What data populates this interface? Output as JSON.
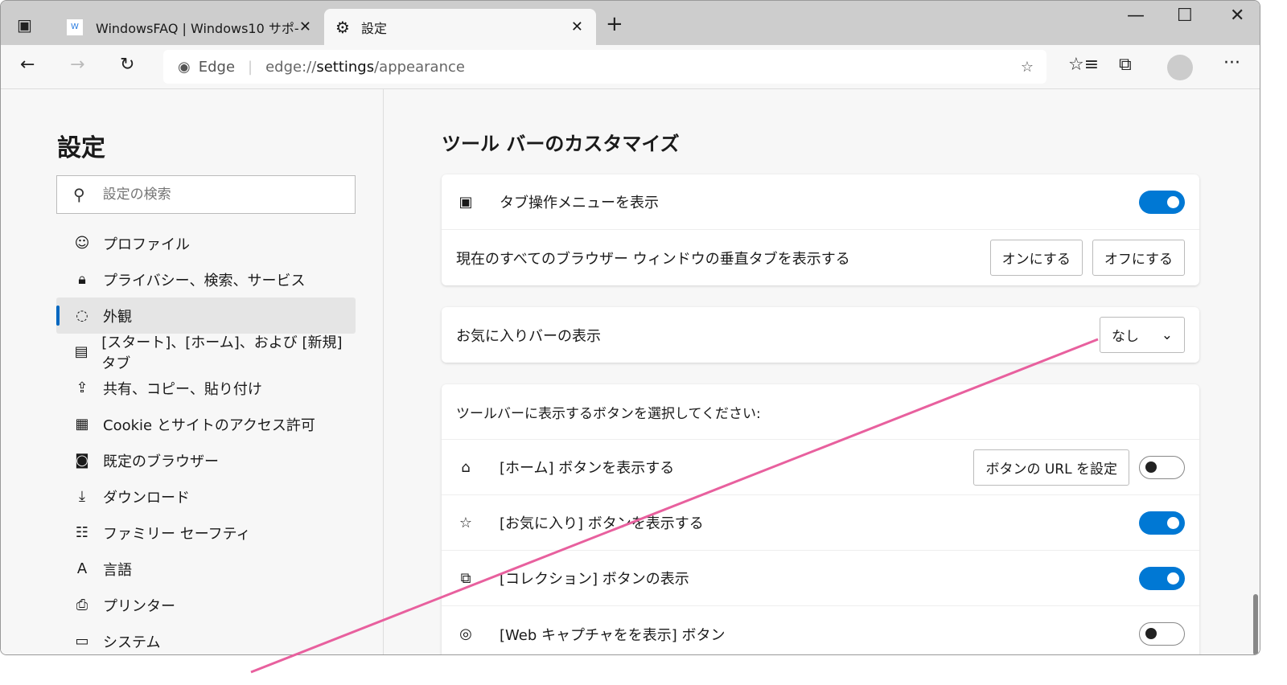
{
  "tabs": [
    {
      "label": "WindowsFAQ | Windows10 サポ-",
      "favicon": "W"
    },
    {
      "label": "設定",
      "icon": "gear-icon"
    }
  ],
  "address": {
    "brand": "Edge",
    "url_prefix": "edge://",
    "url_host": "settings",
    "url_path": "/appearance"
  },
  "sidebar": {
    "title": "設定",
    "search_placeholder": "設定の検索",
    "items": [
      {
        "label": "プロファイル",
        "icon": "profile-icon"
      },
      {
        "label": "プライバシー、検索、サービス",
        "icon": "lock-icon"
      },
      {
        "label": "外観",
        "icon": "palette-icon",
        "selected": true
      },
      {
        "label": "[スタート]、[ホーム]、および [新規] タブ",
        "icon": "newtab-icon"
      },
      {
        "label": "共有、コピー、貼り付け",
        "icon": "share-icon"
      },
      {
        "label": "Cookie とサイトのアクセス許可",
        "icon": "cookie-icon"
      },
      {
        "label": "既定のブラウザー",
        "icon": "browser-icon"
      },
      {
        "label": "ダウンロード",
        "icon": "download-icon"
      },
      {
        "label": "ファミリー セーフティ",
        "icon": "family-icon"
      },
      {
        "label": "言語",
        "icon": "language-icon"
      },
      {
        "label": "プリンター",
        "icon": "printer-icon"
      },
      {
        "label": "システム",
        "icon": "system-icon"
      }
    ]
  },
  "main": {
    "title": "ツール バーのカスタマイズ",
    "tab_menu": {
      "label": "タブ操作メニューを表示",
      "on": true
    },
    "vertical": {
      "label": "現在のすべてのブラウザー ウィンドウの垂直タブを表示する",
      "on_btn": "オンにする",
      "off_btn": "オフにする"
    },
    "favbar": {
      "label": "お気に入りバーの表示",
      "value": "なし"
    },
    "buttons_heading": "ツールバーに表示するボタンを選択してください:",
    "buttons": [
      {
        "label": "[ホーム] ボタンを表示する",
        "extra": "ボタンの URL を設定",
        "on": false,
        "icon": "home-icon"
      },
      {
        "label": "[お気に入り] ボタンを表示する",
        "on": true,
        "icon": "favorites-icon"
      },
      {
        "label": "[コレクション] ボタンの表示",
        "on": true,
        "icon": "collections-icon"
      },
      {
        "label": "[Web キャプチャをを表示] ボタン",
        "on": false,
        "icon": "webcapture-icon"
      }
    ]
  },
  "colors": {
    "accent": "#0078d4",
    "annotation": "#e8609e"
  }
}
